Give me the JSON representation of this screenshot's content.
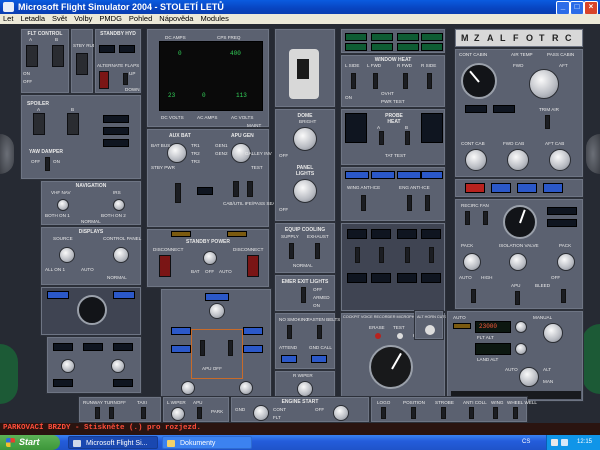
{
  "window": {
    "title": "Microsoft Flight Simulator 2004 - STOLETÍ LETŮ"
  },
  "menu": {
    "items": [
      "Let",
      "Letadla",
      "Svět",
      "Volby",
      "PMDG",
      "Pohled",
      "Nápověda",
      "Modules"
    ]
  },
  "panels": {
    "flt_control": {
      "title": "FLT CONTROL",
      "a": "A",
      "b": "B",
      "stby_rud": "STBY RUD",
      "on": "ON",
      "off": "OFF"
    },
    "standby_hyd": {
      "title": "STANDBY HYD"
    },
    "alternate_flaps": {
      "title": "ALTERNATE FLAPS",
      "up": "UP",
      "down": "DOWN",
      "off": "OFF",
      "arm": "ARM"
    },
    "spoiler": {
      "title": "SPOILER",
      "a": "A",
      "b": "B"
    },
    "yaw_damper": {
      "title": "YAW DAMPER",
      "off": "OFF",
      "on": "ON"
    },
    "navigation": {
      "title": "NAVIGATION",
      "vhf_nav": "VHF NAV",
      "irs": "IRS",
      "both_on1": "BOTH ON 1",
      "both_on2": "BOTH ON 2",
      "normal": "NORMAL"
    },
    "displays": {
      "title": "DISPLAYS",
      "source": "SOURCE",
      "control_panel": "CONTROL PANEL",
      "all_on1": "ALL ON 1",
      "auto": "AUTO",
      "normal": "NORMAL"
    },
    "dc_amps": "DC AMPS",
    "cps_freq": "CPS FREQ",
    "meter_top": [
      "0",
      "400"
    ],
    "meter_bottom": [
      "23",
      "0",
      "113"
    ],
    "dc_volts": "DC VOLTS",
    "ac_amps": "AC AMPS",
    "ac_volts": "AC VOLTS",
    "maint": "MAINT",
    "aux_bat": "AUX BAT",
    "apu_gen": "APU GEN",
    "bat_bus": "BAT BUS",
    "tr": [
      "TR1",
      "TR2",
      "TR3"
    ],
    "stby_pwr": "STBY PWR",
    "test": "TEST",
    "gen": [
      "GEN1",
      "GEN2"
    ],
    "galley_inv": "GALLEY INV",
    "cab_util_ife": "CAB/UTIL IFE/PASS SEAT",
    "standby_power": {
      "title": "STANDBY POWER",
      "disconnect": "DISCONNECT",
      "bat": "BAT",
      "off": "OFF",
      "auto": "AUTO"
    },
    "window_heat": {
      "title": "WINDOW HEAT",
      "l_side": "L SIDE",
      "l_fwd": "L FWD",
      "r_fwd": "R FWD",
      "r_side": "R SIDE",
      "ovht": "OVHT",
      "on": "ON",
      "pwr_test": "PWR TEST"
    },
    "probe": {
      "title": "PROBE",
      "heat": "HEAT",
      "a": "A",
      "b": "B",
      "tat_test": "TAT TEST"
    },
    "dome": {
      "label": "DOME",
      "bright": "BRIGHT",
      "off": "OFF"
    },
    "panel_lights": {
      "label": "PANEL",
      "lights": "LIGHTS",
      "off": "OFF"
    },
    "wing_anti_ice": "WING ANTI-ICE",
    "eng_anti_ice": "ENG ANTI-ICE",
    "equip_cooling": {
      "title": "EQUIP COOLING",
      "supply": "SUPPLY",
      "exhaust": "EXHAUST",
      "normal": "NORMAL"
    },
    "emer_exit_lights": {
      "title": "EMER EXIT LIGHTS",
      "off": "OFF",
      "armed": "ARMED",
      "on": "ON"
    },
    "no_smoking": "NO SMOKING",
    "fasten_belts": "FASTEN BELTS",
    "attend": "ATTEND",
    "gnd_call": "GND CALL",
    "voice_recorder": "COCKPIT VOICE RECORDER MICROPHONE MONITOR",
    "erase": "ERASE",
    "test_btn": "TEST",
    "headphone": "HEADPHONE",
    "alt_horn_cutout": "ALT HORN CUTOUT",
    "cabin": {
      "letters": [
        "M",
        "Z",
        "A",
        "L",
        "F",
        "O",
        "T",
        "R",
        "C"
      ],
      "cont_cabin": "CONT CABIN",
      "air_temp": "AIR TEMP",
      "pass_cabin": "PASS CABIN",
      "fwd": "FWD",
      "aft": "AFT",
      "trim_air": "TRIM AIR",
      "cont_cab": "CONT CAB",
      "fwd_cab": "FWD CAB",
      "aft_cab": "AFT CAB"
    },
    "pressurization": {
      "recirc_fan": "RECIRC FAN",
      "pack": "PACK",
      "isolation_valve": "ISOLATION VALVE",
      "apu": "APU",
      "bleed": "BLEED",
      "auto": "AUTO",
      "off": "OFF",
      "high": "HIGH"
    },
    "press_mode": {
      "auto_readout": "23000",
      "manual": "MANUAL",
      "flt_alt": "FLT ALT",
      "land_alt": "LAND ALT",
      "auto": "AUTO",
      "man": "MAN",
      "alt": "ALT"
    },
    "lower": {
      "apu_off": "APU OFF",
      "wiper_l": "L WIPER",
      "wiper_r": "R WIPER",
      "park": "PARK",
      "int": "INT",
      "low": "LOW",
      "high": "HIGH",
      "engine_start": "ENGINE START",
      "cont": "CONT",
      "gnd": "GND",
      "flt": "FLT",
      "runway_turnoff": "RUNWAY TURNOFF",
      "taxi": "TAXI",
      "logo": "LOGO",
      "position": "POSITION",
      "strobe": "STROBE",
      "anti_coll": "ANTI COLL",
      "wing": "WING",
      "wheel_well": "WHEEL WELL"
    }
  },
  "status_message": "PARKOVACÍ BRZDY - Stiskněte (.) pro rozjezd.",
  "taskbar": {
    "start": "Start",
    "tasks": [
      "Microsoft Flight Si...",
      "Dokumenty"
    ],
    "lang": "CS",
    "clock": "12:15"
  }
}
